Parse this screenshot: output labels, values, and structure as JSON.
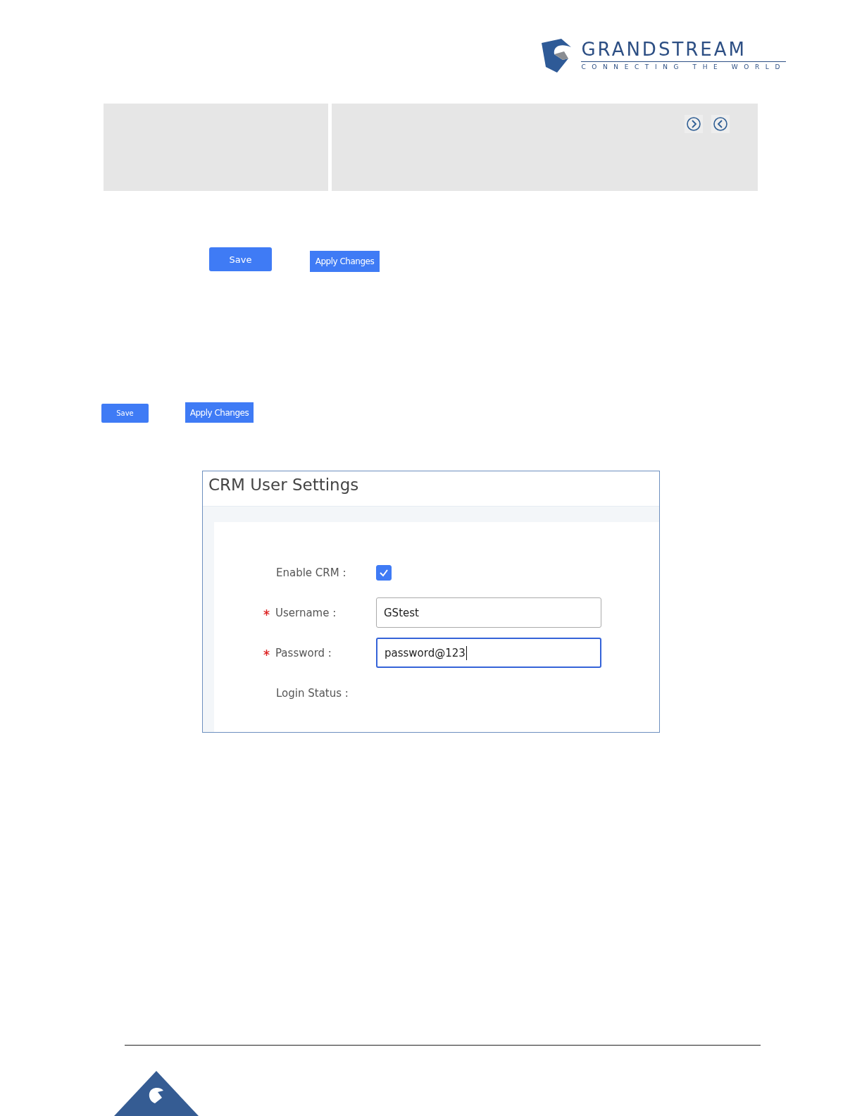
{
  "header": {
    "brand": "GRANDSTREAM",
    "tagline": "CONNECTING THE WORLD"
  },
  "toolbar_panels": {
    "icons": [
      {
        "kind": "next"
      },
      {
        "kind": "prev"
      }
    ]
  },
  "button_rows": [
    {
      "kind": "large",
      "buttons": [
        "Save",
        "Apply Changes"
      ]
    },
    {
      "kind": "small",
      "buttons": [
        "Save",
        "Apply Changes"
      ]
    }
  ],
  "crm_panel": {
    "title": "CRM User Settings",
    "fields": [
      {
        "kind": "checkbox",
        "label": "Enable CRM :",
        "required": false,
        "checked": true
      },
      {
        "kind": "text",
        "label": "Username :",
        "required": true,
        "value": "GStest",
        "focused": false
      },
      {
        "kind": "text",
        "label": "Password :",
        "required": true,
        "value": "password@123",
        "focused": true
      },
      {
        "kind": "status",
        "label": "Login Status :",
        "required": false
      }
    ]
  }
}
